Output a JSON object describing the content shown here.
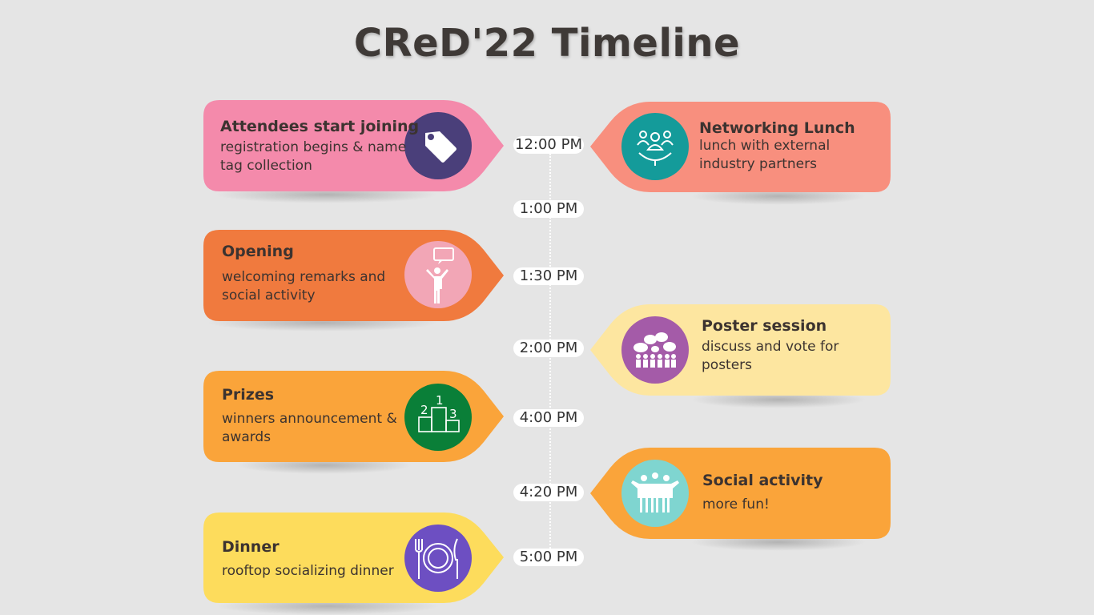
{
  "title": "CReD'22 Timeline",
  "times": [
    "12:00 PM",
    "1:00 PM",
    "1:30 PM",
    "2:00 PM",
    "4:00 PM",
    "4:20 PM",
    "5:00 PM"
  ],
  "events": {
    "attendees": {
      "title": "Attendees start joining",
      "desc": "registration begins & name tag collection",
      "color": "#f48aab",
      "icon_bg": "#4a3f7a",
      "icon": "tag-icon"
    },
    "networking": {
      "title": "Networking Lunch",
      "desc": "lunch with external industry partners",
      "color": "#f88f7e",
      "icon_bg": "#149b9a",
      "icon": "people-network-icon"
    },
    "opening": {
      "title": "Opening",
      "desc": "welcoming remarks and social activity",
      "color": "#f07a3e",
      "icon_bg": "#f2a6b6",
      "icon": "speaker-icon"
    },
    "poster": {
      "title": "Poster session",
      "desc": "discuss and vote for posters",
      "color": "#fde6a0",
      "icon_bg": "#a45ba8",
      "icon": "discussion-group-icon"
    },
    "prizes": {
      "title": "Prizes",
      "desc": "winners announcement & awards",
      "color": "#faa43a",
      "icon_bg": "#0a7f38",
      "icon": "podium-icon"
    },
    "social": {
      "title": "Social activity",
      "desc": "more fun!",
      "color": "#faa43a",
      "icon_bg": "#7fd5d0",
      "icon": "friends-icon"
    },
    "dinner": {
      "title": "Dinner",
      "desc": "rooftop socializing dinner",
      "color": "#fddc5c",
      "icon_bg": "#6d4fc2",
      "icon": "plate-cutlery-icon"
    }
  }
}
